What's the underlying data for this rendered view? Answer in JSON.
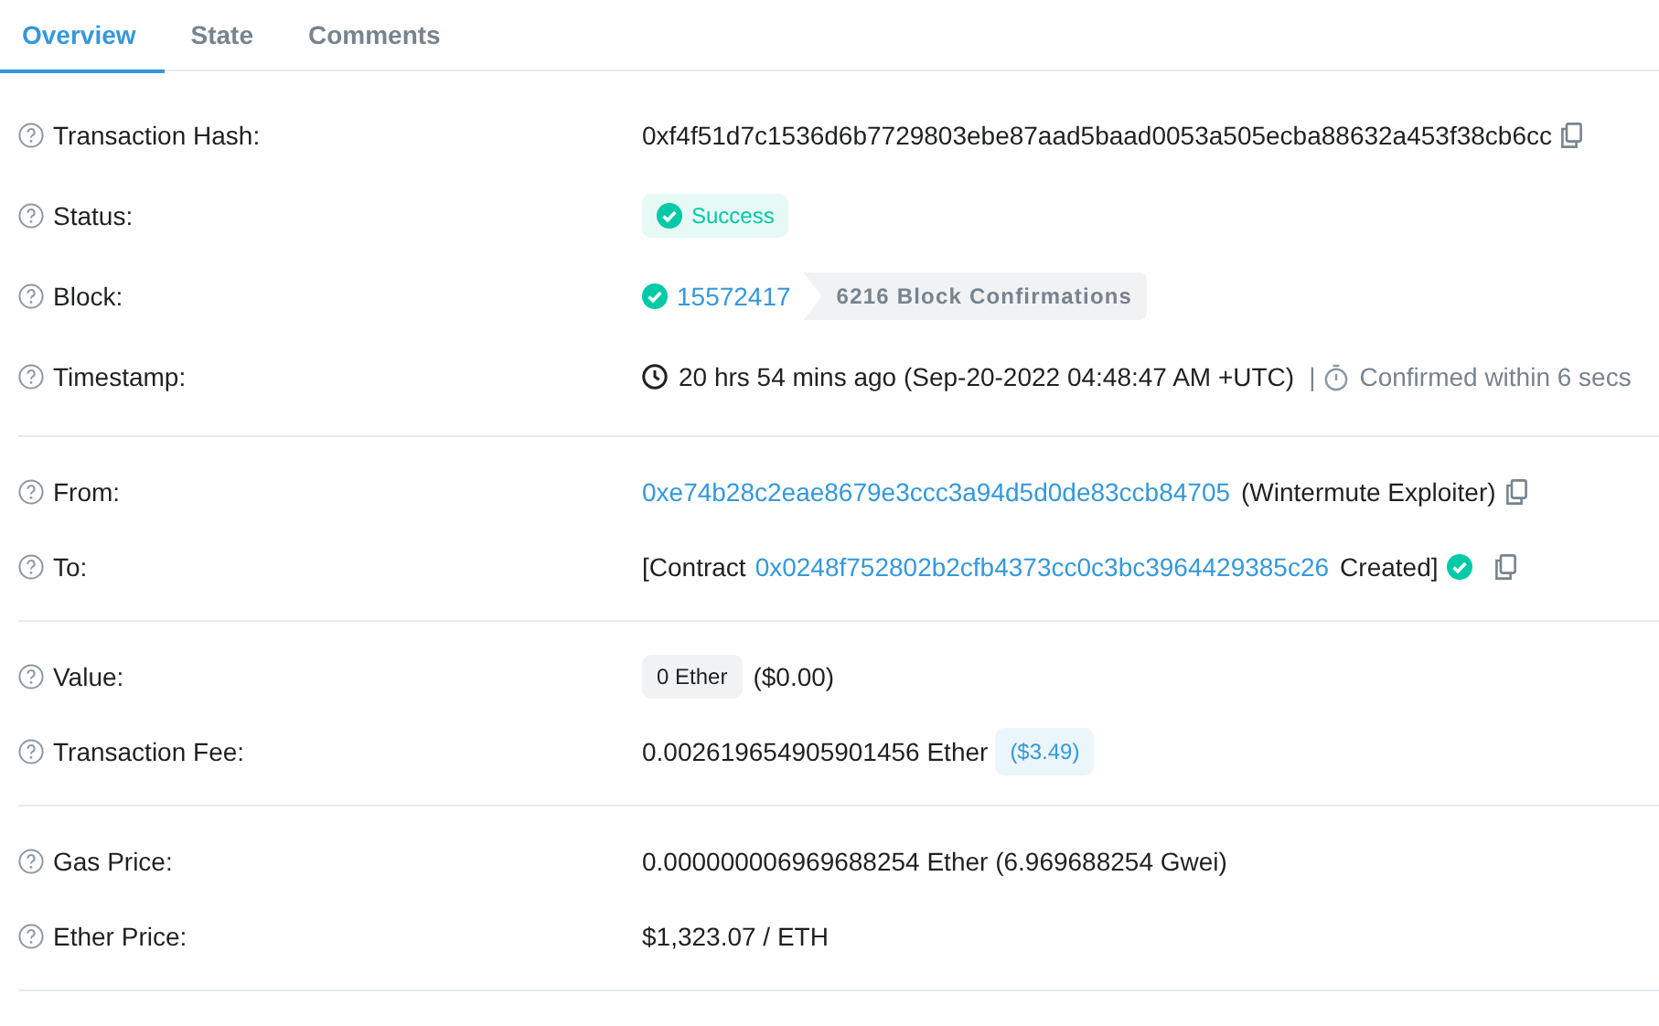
{
  "tabs": [
    {
      "label": "Overview",
      "selected": true
    },
    {
      "label": "State",
      "selected": false
    },
    {
      "label": "Comments",
      "selected": false
    }
  ],
  "sections": [
    {
      "rows": [
        {
          "label": "Transaction Hash:",
          "parts": [
            {
              "kind": "text",
              "text": "0xf4f51d7c1536d6b7729803ebe87aad5baad0053a505ecba88632a453f38cb6cc"
            },
            {
              "kind": "copy"
            }
          ]
        },
        {
          "label": "Status:",
          "parts": [
            {
              "kind": "status",
              "text": "Success"
            }
          ]
        },
        {
          "label": "Block:",
          "parts": [
            {
              "kind": "check"
            },
            {
              "kind": "link",
              "text": "15572417"
            },
            {
              "kind": "confirmations",
              "text": "6216 Block Confirmations"
            }
          ]
        },
        {
          "label": "Timestamp:",
          "parts": [
            {
              "kind": "clock"
            },
            {
              "kind": "text",
              "text": "20 hrs 54 mins ago (Sep-20-2022 04:48:47 AM +UTC)"
            },
            {
              "kind": "muted",
              "text": "|"
            },
            {
              "kind": "timer"
            },
            {
              "kind": "muted",
              "text": "Confirmed within 6 secs"
            }
          ]
        }
      ]
    },
    {
      "rows": [
        {
          "label": "From:",
          "parts": [
            {
              "kind": "link",
              "text": "0xe74b28c2eae8679e3ccc3a94d5d0de83ccb84705"
            },
            {
              "kind": "text",
              "text": "(Wintermute Exploiter)"
            },
            {
              "kind": "copy"
            }
          ]
        },
        {
          "label": "To:",
          "parts": [
            {
              "kind": "text",
              "text": "[Contract"
            },
            {
              "kind": "link",
              "text": "0x0248f752802b2cfb4373cc0c3bc3964429385c26"
            },
            {
              "kind": "text",
              "text": "Created]"
            },
            {
              "kind": "check"
            },
            {
              "kind": "copy"
            }
          ]
        }
      ]
    },
    {
      "rows": [
        {
          "label": "Value:",
          "parts": [
            {
              "kind": "pill",
              "text": "0 Ether"
            },
            {
              "kind": "text",
              "text": "($0.00)"
            }
          ]
        },
        {
          "label": "Transaction Fee:",
          "parts": [
            {
              "kind": "text",
              "text": "0.002619654905901456 Ether"
            },
            {
              "kind": "usd",
              "text": "($3.49)"
            }
          ]
        }
      ]
    },
    {
      "rows": [
        {
          "label": "Gas Price:",
          "parts": [
            {
              "kind": "text",
              "text": "0.000000006969688254 Ether (6.969688254 Gwei)"
            }
          ]
        },
        {
          "label": "Ether Price:",
          "parts": [
            {
              "kind": "text",
              "text": "$1,323.07 / ETH"
            }
          ]
        }
      ]
    }
  ]
}
